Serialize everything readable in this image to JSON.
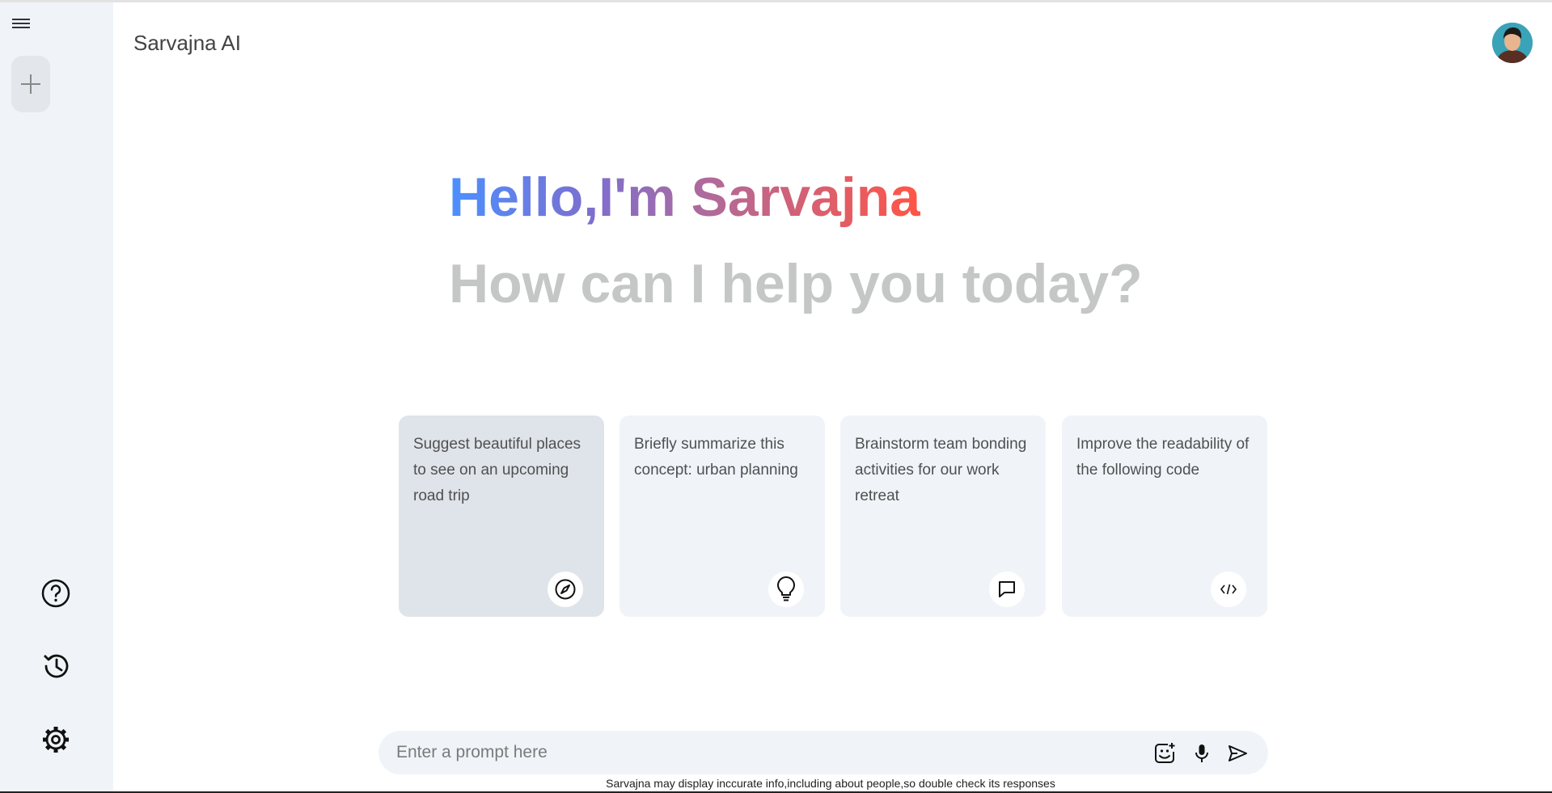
{
  "app": {
    "title": "Sarvajna AI"
  },
  "greeting": {
    "hello": "Hello,I'm Sarvajna",
    "question": "How can I help you today?"
  },
  "cards": [
    {
      "text": "Suggest beautiful places to see on an upcoming road trip",
      "icon": "compass-icon"
    },
    {
      "text": "Briefly summarize this concept: urban planning",
      "icon": "bulb-icon"
    },
    {
      "text": "Brainstorm team bonding activities for our work retreat",
      "icon": "message-icon"
    },
    {
      "text": "Improve the readability of the following code",
      "icon": "code-icon"
    }
  ],
  "prompt": {
    "placeholder": "Enter a prompt here",
    "value": ""
  },
  "disclaimer": "Sarvajna may display inccurate info,including about people,so double check its responses",
  "sidebar": {
    "icons": [
      "menu-icon",
      "plus-icon",
      "help-icon",
      "history-icon",
      "settings-icon"
    ]
  },
  "colors": {
    "gradient_start": "#4b90ff",
    "gradient_end": "#ff5546",
    "sidebar_bg": "#f0f4f9",
    "card_bg": "#f0f4f9"
  }
}
